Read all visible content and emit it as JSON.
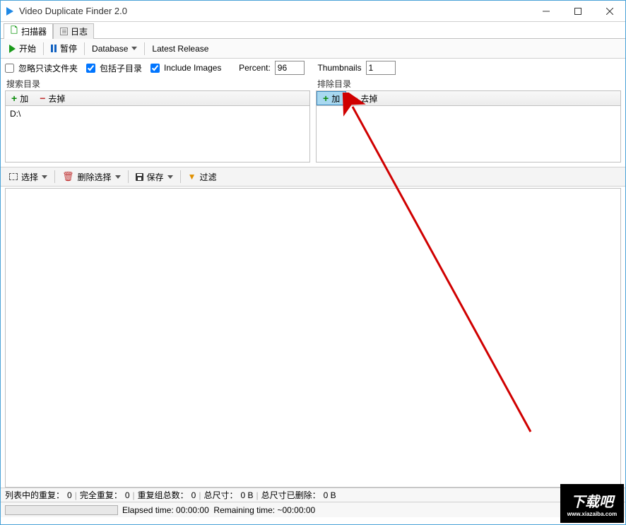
{
  "titlebar": {
    "title": "Video Duplicate Finder 2.0"
  },
  "tabs": {
    "scanner": "扫描器",
    "log": "日志"
  },
  "toolbar": {
    "start": "开始",
    "pause": "暂停",
    "database": "Database",
    "latest_release": "Latest Release"
  },
  "options": {
    "ignore_readonly": "忽略只读文件夹",
    "include_subdirs": "包括子目录",
    "include_images": "Include Images",
    "percent_label": "Percent:",
    "percent_value": "96",
    "thumbnails_label": "Thumbnails",
    "thumbnails_value": "1"
  },
  "search_dirs": {
    "title": "搜索目录",
    "add": "加",
    "remove": "去掉",
    "items": [
      "D:\\"
    ]
  },
  "exclude_dirs": {
    "title": "排除目录",
    "add": "加",
    "remove": "去掉"
  },
  "toolbar2": {
    "select": "选择",
    "delete_selection": "删除选择",
    "save": "保存",
    "filter": "过滤"
  },
  "status": {
    "list_dup_label": "列表中的重复：",
    "list_dup_value": "0",
    "full_dup_label": "完全重复：",
    "full_dup_value": "0",
    "group_count_label": "重复组总数：",
    "group_count_value": "0",
    "total_size_label": "总尺寸：",
    "total_size_value": "0 B",
    "deleted_size_label": "总尺寸已删除：",
    "deleted_size_value": "0 B",
    "elapsed": "Elapsed time: 00:00:00",
    "remaining": "Remaining time: ~00:00:00"
  },
  "watermark": {
    "big": "下载吧",
    "small": "www.xiazaiba.com"
  }
}
